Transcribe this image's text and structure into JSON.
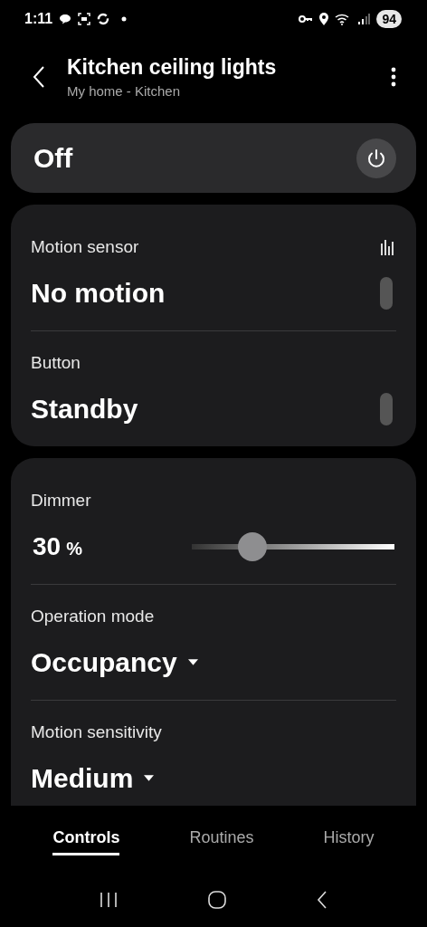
{
  "status_bar": {
    "time": "1:11",
    "battery": "94"
  },
  "header": {
    "title": "Kitchen ceiling lights",
    "subtitle": "My home - Kitchen"
  },
  "power": {
    "label": "Off",
    "on": false
  },
  "sensor_card": [
    {
      "kind": "status",
      "label": "Motion sensor",
      "value": "No motion",
      "history_icon": true
    },
    {
      "kind": "status",
      "label": "Button",
      "value": "Standby",
      "history_icon": false
    }
  ],
  "control_card": [
    {
      "kind": "slider",
      "label": "Dimmer",
      "value": "30",
      "unit": "%",
      "level": 0.3
    },
    {
      "kind": "dropdown",
      "label": "Operation mode",
      "value": "Occupancy"
    },
    {
      "kind": "dropdown",
      "label": "Motion sensitivity",
      "value": "Medium"
    }
  ],
  "tabs": [
    {
      "label": "Controls",
      "selected": true
    },
    {
      "label": "Routines",
      "selected": false
    },
    {
      "label": "History",
      "selected": false
    }
  ]
}
